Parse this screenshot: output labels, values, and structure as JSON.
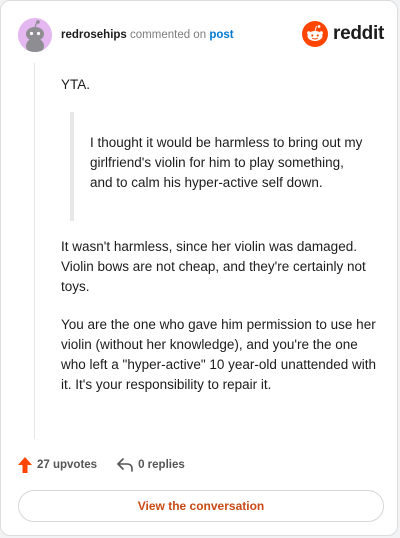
{
  "header": {
    "username": "redrosehips",
    "action": "commented on",
    "post_link": "post",
    "logo_text": "reddit"
  },
  "icons": {
    "avatar": "snoo-avatar-icon",
    "logo": "reddit-snoo-icon",
    "upvote": "upvote-arrow-icon",
    "reply": "reply-arrow-icon"
  },
  "comment": {
    "verdict": "YTA.",
    "quote": "I thought it would be harmless to bring out my girlfriend's violin for him to play something, and to calm his hyper-active self down.",
    "paragraph1": "It wasn't harmless, since her violin was damaged. Violin bows are not cheap, and they're certainly not toys.",
    "paragraph2": "You are the one who gave him permission to use her violin (without her knowledge), and you're the one who left a \"hyper-active\" 10 year-old unattended with it. It's your responsibility to repair it."
  },
  "footer": {
    "upvotes": "27 upvotes",
    "replies": "0 replies",
    "cta": "View the conversation"
  },
  "colors": {
    "brand_orange": "#ff4500",
    "link_blue": "#0079d3",
    "cta_text": "#c94a14",
    "avatar_bg": "#e4b7f0"
  }
}
